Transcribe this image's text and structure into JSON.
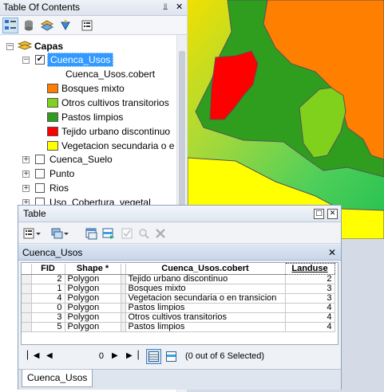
{
  "toc": {
    "title": "Table Of Contents",
    "pin_icon": "pin-icon",
    "close_icon": "close-icon",
    "root": "Capas",
    "layers": [
      {
        "name": "Cuenca_Usos",
        "checked": true,
        "expanded": true
      },
      {
        "name": "Cuenca_Suelo",
        "checked": false,
        "expanded": false
      },
      {
        "name": "Punto",
        "checked": false,
        "expanded": false
      },
      {
        "name": "Rios",
        "checked": false,
        "expanded": false
      },
      {
        "name": "Uso_Cobertura_vegetal",
        "checked": false,
        "expanded": false
      }
    ],
    "legend_field": "Cuenca_Usos.cobert",
    "legend": [
      {
        "label": "Bosques mixto",
        "color": "#ff7f00"
      },
      {
        "label": "Otros cultivos transitorios",
        "color": "#7fd11b"
      },
      {
        "label": "Pastos limpios",
        "color": "#2f9e1f"
      },
      {
        "label": "Tejido urbano discontinuo",
        "color": "#ff0000"
      },
      {
        "label": "Vegetacion secundaria o e",
        "color": "#ffff00"
      }
    ]
  },
  "table_window": {
    "title": "Table",
    "tab_name": "Cuenca_Usos",
    "columns": [
      "FID",
      "Shape *",
      "Cuenca_Usos.cobert",
      "Landuse"
    ],
    "rows": [
      {
        "fid": "2",
        "shape": "Polygon",
        "cobert": "Tejido urbano discontinuo",
        "landuse": "2"
      },
      {
        "fid": "1",
        "shape": "Polygon",
        "cobert": "Bosques mixto",
        "landuse": "3"
      },
      {
        "fid": "4",
        "shape": "Polygon",
        "cobert": "Vegetacion secundaria o en transicion",
        "landuse": "3"
      },
      {
        "fid": "0",
        "shape": "Polygon",
        "cobert": "Pastos limpios",
        "landuse": "4"
      },
      {
        "fid": "3",
        "shape": "Polygon",
        "cobert": "Otros cultivos transitorios",
        "landuse": "4"
      },
      {
        "fid": "5",
        "shape": "Polygon",
        "cobert": "Pastos limpios",
        "landuse": "4"
      }
    ],
    "record_number": "0",
    "selection_status": "(0 out of 6 Selected)",
    "bottom_tab": "Cuenca_Usos"
  }
}
